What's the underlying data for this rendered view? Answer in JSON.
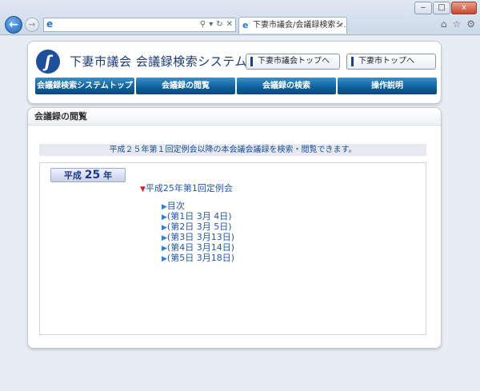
{
  "browser": {
    "tab_title": "下妻市議会/会議録検索シ...",
    "address_value": "",
    "min_label": "‒",
    "max_label": "□",
    "close_label": "x"
  },
  "header": {
    "site_title": "下妻市議会  会議録検索システム",
    "top_links": [
      "下妻市議会トップへ",
      "下妻市トップへ"
    ],
    "nav_items": [
      "会議録検索システムトップ",
      "会議録の閲覧",
      "会議録の検索",
      "操作説明"
    ]
  },
  "section": {
    "title": "会議録の閲覧",
    "info": "平成２５年第１回定例会以降の本会議会議録を検索・閲覧できます。",
    "year_label_prefix": "平成",
    "year_number": "25",
    "year_label_suffix": "年",
    "session_title": "平成25年第1回定例会",
    "items": [
      "目次",
      "(第1日 3月 4日)",
      "(第2日 3月 5日)",
      "(第3日 3月13日)",
      "(第4日 3月14日)",
      "(第5日 3月18日)"
    ]
  }
}
